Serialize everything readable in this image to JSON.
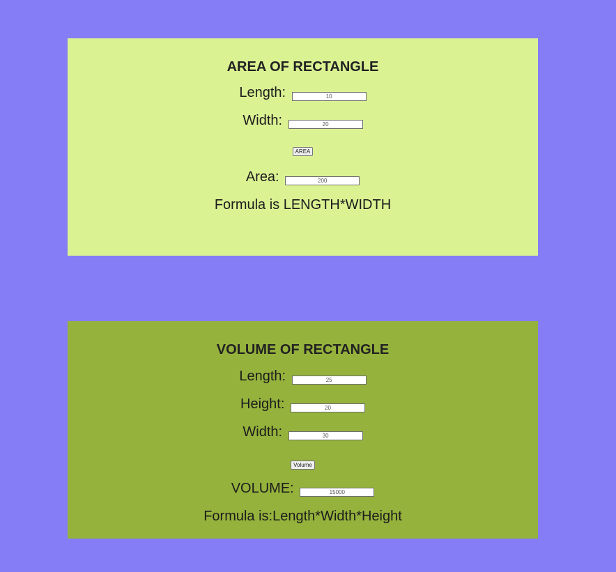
{
  "area": {
    "title": "AREA OF RECTANGLE",
    "length_label": "Length:",
    "length_value": "10",
    "width_label": "Width:",
    "width_value": "20",
    "button_label": "AREA",
    "result_label": "Area:",
    "result_value": "200",
    "formula": "Formula is LENGTH*WIDTH",
    "panel_color": "#dbf293"
  },
  "volume": {
    "title": "VOLUME OF RECTANGLE",
    "length_label": "Length:",
    "length_value": "25",
    "height_label": "Height:",
    "height_value": "20",
    "width_label": "Width:",
    "width_value": "30",
    "button_label": "Volume",
    "result_label": "VOLUME:",
    "result_value": "15000",
    "formula": "Formula is:Length*Width*Height",
    "panel_color": "#95b23c"
  },
  "page": {
    "background_color": "#857df5"
  }
}
